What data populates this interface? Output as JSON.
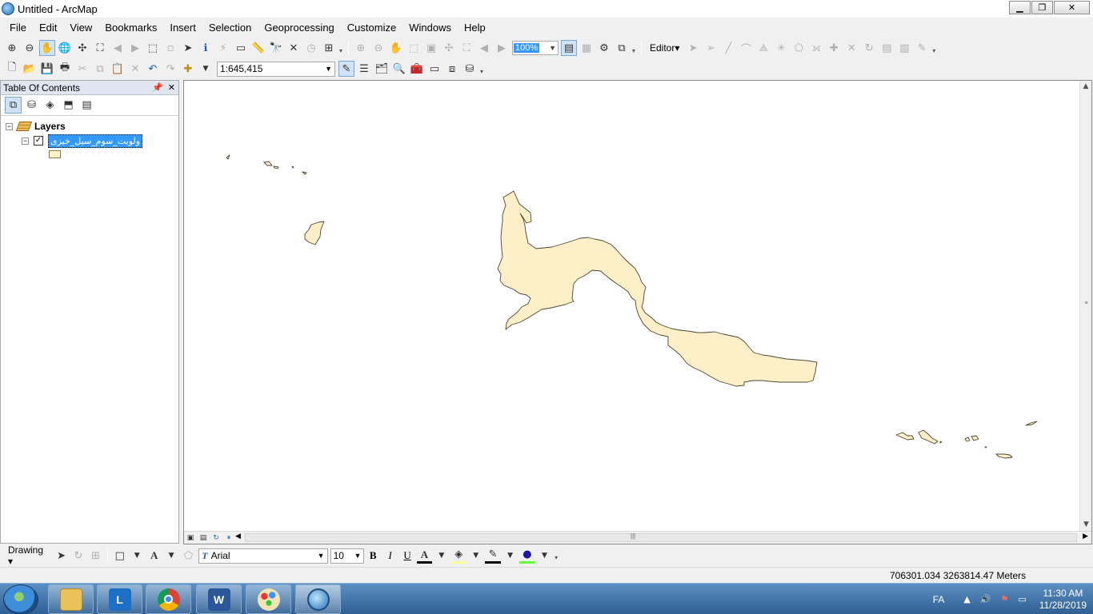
{
  "window": {
    "title": "Untitled - ArcMap",
    "minimize": "▁",
    "maximize": "❐",
    "close": "✕"
  },
  "menu": [
    "File",
    "Edit",
    "View",
    "Bookmarks",
    "Insert",
    "Selection",
    "Geoprocessing",
    "Customize",
    "Windows",
    "Help"
  ],
  "toolbar": {
    "zoom_percent": "100%",
    "editor_label": "Editor▾",
    "scale": "1:645,415"
  },
  "toc": {
    "title": "Table Of Contents",
    "pin": "📌",
    "close": "✕",
    "group_label": "Layers",
    "layer_name": "ولویت_سوم_سیل_خیزی",
    "layer_checked": "✓",
    "swatch_color": "#fff3c7"
  },
  "map": {
    "fill_color": "#fdf0c8",
    "stroke_color": "#4d4433"
  },
  "drawing": {
    "label": "Drawing ▾",
    "font": "Arial",
    "font_size": "10",
    "bold": "B",
    "italic": "I",
    "underline": "U"
  },
  "status": {
    "coordinates": "706301.034  3263814.47 Meters"
  },
  "taskbar": {
    "language": "FA",
    "time": "11:30 AM",
    "date": "11/28/2019"
  }
}
